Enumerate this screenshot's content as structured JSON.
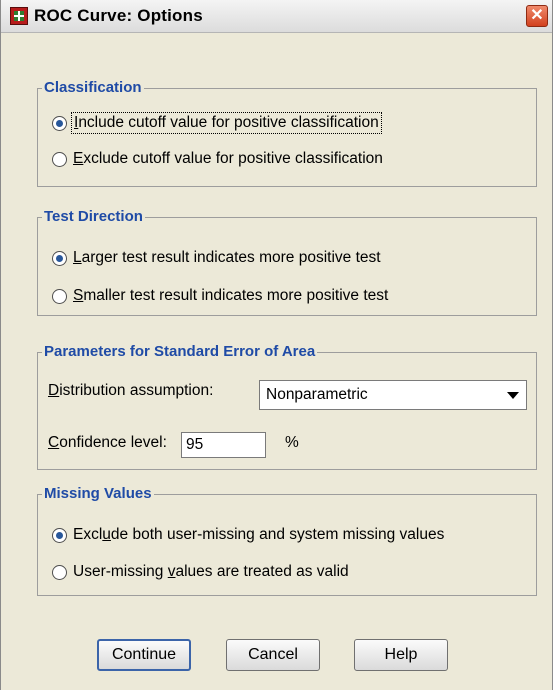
{
  "window": {
    "title": "ROC Curve: Options",
    "close_glyph": "✕"
  },
  "groups": {
    "classification": {
      "title": "Classification",
      "options": [
        {
          "pre": "",
          "mnemonic": "I",
          "post": "nclude cutoff value for positive classification",
          "selected": true
        },
        {
          "pre": "",
          "mnemonic": "E",
          "post": "xclude cutoff value for positive classification",
          "selected": false
        }
      ]
    },
    "test_direction": {
      "title": "Test Direction",
      "options": [
        {
          "pre": "",
          "mnemonic": "L",
          "post": "arger test result indicates more positive test",
          "selected": true
        },
        {
          "pre": "",
          "mnemonic": "S",
          "post": "maller test result indicates more positive test",
          "selected": false
        }
      ]
    },
    "parameters": {
      "title": "Parameters for Standard Error of Area",
      "distribution_label_mnemonic": "D",
      "distribution_label_rest": "istribution assumption:",
      "distribution_value": "Nonparametric",
      "confidence_label_mnemonic": "C",
      "confidence_label_rest": "onfidence level:",
      "confidence_value": "95",
      "confidence_unit": "%"
    },
    "missing_values": {
      "title": "Missing Values",
      "options": [
        {
          "pre": "Excl",
          "mnemonic": "u",
          "post": "de both user-missing and system missing values",
          "selected": true
        },
        {
          "pre": "User-missing ",
          "mnemonic": "v",
          "post": "alues are treated as valid",
          "selected": false
        }
      ]
    }
  },
  "buttons": {
    "continue": "Continue",
    "cancel": "Cancel",
    "help": "Help"
  },
  "colors": {
    "accent": "#1f4ba6",
    "dialog_bg": "#ece9d8",
    "close": "#d2411f"
  },
  "icons": {
    "app": "spss-roc-icon",
    "close": "close-icon",
    "dropdown": "chevron-down-icon"
  }
}
